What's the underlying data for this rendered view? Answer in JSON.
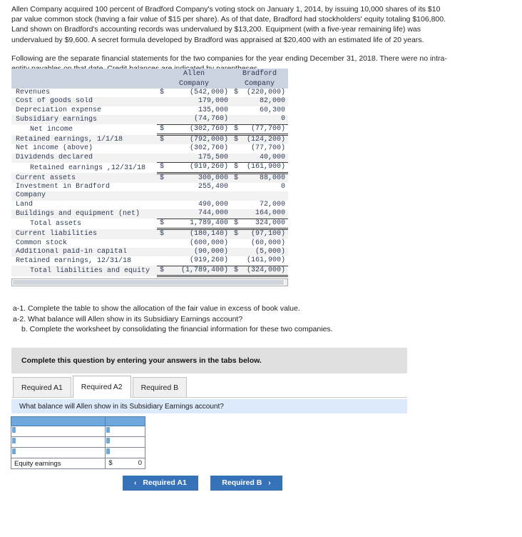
{
  "intro": {
    "paragraph1": "Allen Company acquired 100 percent of Bradford Company's voting stock on January 1, 2014, by issuing 10,000 shares of its $10 par value common stock (having a fair value of $15 per share). As of that date, Bradford had stockholders' equity totaling $106,800. Land shown on Bradford's accounting records was undervalued by $13,200. Equipment (with a five-year remaining life) was undervalued by $9,600. A secret formula developed by Bradford was appraised at $20,400 with an estimated life of 20 years.",
    "paragraph2": "Following are the separate financial statements for the two companies for the year ending December 31, 2018. There were no intra-entity payables on that date. Credit balances are indicated by parentheses."
  },
  "financials": {
    "col1_line1": "Allen",
    "col1_line2": "Company",
    "col2_line1": "Bradford",
    "col2_line2": "Company",
    "rows": [
      {
        "label": "Revenues",
        "indent": false,
        "allen_sym": "$",
        "allen": "(542,000)",
        "brad_sym": "$",
        "brad": "(220,000)"
      },
      {
        "label": "Cost of goods sold",
        "indent": false,
        "allen_sym": "",
        "allen": "179,000",
        "brad_sym": "",
        "brad": "82,000"
      },
      {
        "label": "Depreciation expense",
        "indent": false,
        "allen_sym": "",
        "allen": "135,000",
        "brad_sym": "",
        "brad": "60,300"
      },
      {
        "label": "Subsidiary earnings",
        "indent": false,
        "allen_sym": "",
        "allen": "(74,760)",
        "brad_sym": "",
        "brad": "0",
        "rule": "bottom"
      },
      {
        "label": "Net income",
        "indent": true,
        "allen_sym": "$",
        "allen": "(302,760)",
        "brad_sym": "$",
        "brad": "(77,700)",
        "rule": "bottomdouble"
      },
      {
        "label": "Retained earnings, 1/1/18",
        "indent": false,
        "allen_sym": "$",
        "allen": "(792,000)",
        "brad_sym": "$",
        "brad": "(124,200)"
      },
      {
        "label": "Net income (above)",
        "indent": false,
        "allen_sym": "",
        "allen": "(302,760)",
        "brad_sym": "",
        "brad": "(77,700)"
      },
      {
        "label": "Dividends declared",
        "indent": false,
        "allen_sym": "",
        "allen": "175,500",
        "brad_sym": "",
        "brad": "40,000",
        "rule": "bottom"
      },
      {
        "label": "Retained earnings ,12/31/18",
        "indent": true,
        "allen_sym": "$",
        "allen": "(919,260)",
        "brad_sym": "$",
        "brad": "(161,900)",
        "rule": "bottomdouble"
      },
      {
        "label": "Current assets",
        "indent": false,
        "allen_sym": "$",
        "allen": "300,000",
        "brad_sym": "$",
        "brad": "88,000"
      },
      {
        "label": "Investment in Bradford",
        "indent": false,
        "allen_sym": "",
        "allen": "255,400",
        "brad_sym": "",
        "brad": "0"
      },
      {
        "label": "Company",
        "indent": false,
        "allen_sym": "",
        "allen": "",
        "brad_sym": "",
        "brad": ""
      },
      {
        "label": "Land",
        "indent": false,
        "allen_sym": "",
        "allen": "490,000",
        "brad_sym": "",
        "brad": "72,000"
      },
      {
        "label": "Buildings and equipment (net)",
        "indent": false,
        "allen_sym": "",
        "allen": "744,000",
        "brad_sym": "",
        "brad": "164,000",
        "rule": "bottom"
      },
      {
        "label": "Total assets",
        "indent": true,
        "allen_sym": "$",
        "allen": "1,789,400",
        "brad_sym": "$",
        "brad": "324,000",
        "rule": "bottomdouble"
      },
      {
        "label": "Current liabilities",
        "indent": false,
        "allen_sym": "$",
        "allen": "(180,140)",
        "brad_sym": "$",
        "brad": "(97,100)"
      },
      {
        "label": "Common stock",
        "indent": false,
        "allen_sym": "",
        "allen": "(600,000)",
        "brad_sym": "",
        "brad": "(60,000)"
      },
      {
        "label": "Additional paid-in capital",
        "indent": false,
        "allen_sym": "",
        "allen": "(90,000)",
        "brad_sym": "",
        "brad": "(5,000)"
      },
      {
        "label": "Retained earnings, 12/31/18",
        "indent": false,
        "allen_sym": "",
        "allen": "(919,260)",
        "brad_sym": "",
        "brad": "(161,900)",
        "rule": "bottom"
      },
      {
        "label": "Total liabilities and equity",
        "indent": true,
        "allen_sym": "$",
        "allen": "(1,789,400)",
        "brad_sym": "$",
        "brad": "(324,000)",
        "rule": "bottomdouble",
        "tight": true
      }
    ]
  },
  "requirements": {
    "a1": "a-1. Complete the table to show the allocation of the fair value in excess of book value.",
    "a2": "a-2. What balance will Allen show in its Subsidiary Earnings account?",
    "b": "b. Complete the worksheet by consolidating the financial information for these two companies."
  },
  "banner": {
    "text": "Complete this question by entering your answers in the tabs below."
  },
  "tabs": {
    "items": [
      {
        "label": "Required A1",
        "active": false
      },
      {
        "label": "Required A2",
        "active": true
      },
      {
        "label": "Required B",
        "active": false
      }
    ]
  },
  "question": {
    "text": "What balance will Allen show in its Subsidiary Earnings account?"
  },
  "answer_grid": {
    "header": {
      "col1": "",
      "col2": ""
    },
    "input_rows": [
      {
        "label": "",
        "value": ""
      },
      {
        "label": "",
        "value": ""
      },
      {
        "label": "",
        "value": ""
      }
    ],
    "total_row": {
      "label": "Equity earnings",
      "symbol": "$",
      "value": "0"
    }
  },
  "nav": {
    "prev_label": "Required A1",
    "next_label": "Required B",
    "prev_chevron": "‹",
    "next_chevron": "›"
  },
  "colors": {
    "table_header_bg": "#ccd3e0",
    "grid_header_blue": "#6fa8dc",
    "question_strip_blue": "#dceafb",
    "banner_grey": "#e0e0e0",
    "button_blue": "#3572b8"
  }
}
